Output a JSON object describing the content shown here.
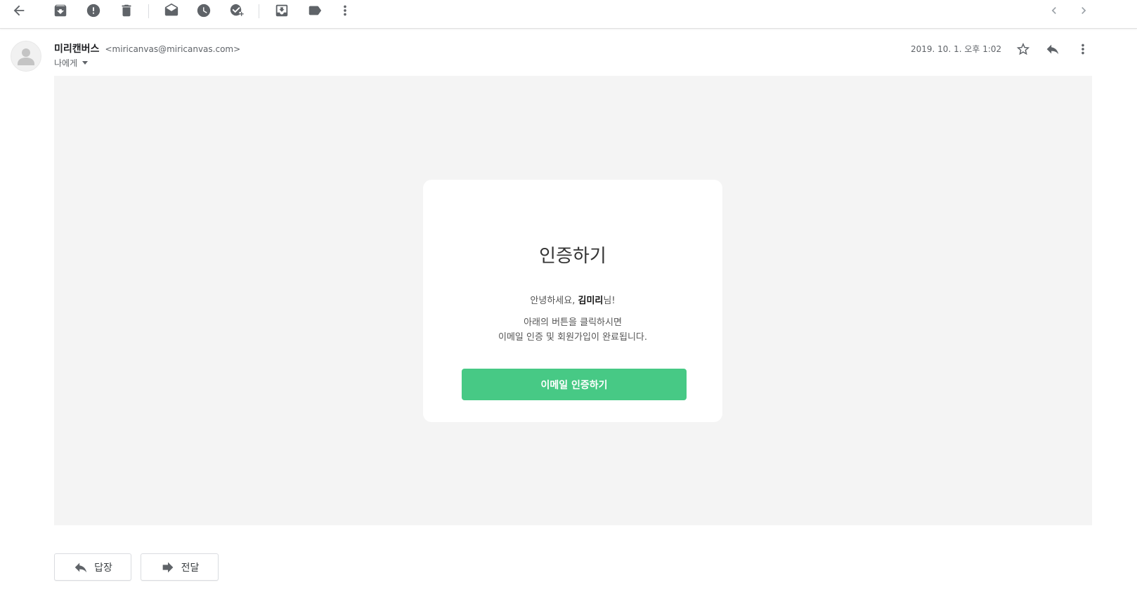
{
  "toolbar": {
    "icons": [
      "back-arrow-icon",
      "archive-icon",
      "report-spam-icon",
      "delete-icon",
      "mark-unread-icon",
      "snooze-icon",
      "add-to-tasks-icon",
      "move-to-icon",
      "label-icon",
      "more-vert-icon"
    ],
    "nav": [
      "chevron-left-icon",
      "chevron-right-icon"
    ]
  },
  "message": {
    "sender_name": "미리캔버스",
    "sender_email": "<miricanvas@miricanvas.com>",
    "to_label": "나에게",
    "date": "2019. 10. 1. 오후 1:02"
  },
  "card": {
    "title": "인증하기",
    "greeting_prefix": "안녕하세요, ",
    "greeting_name": "김미리",
    "greeting_suffix": "님!",
    "line1": "아래의 버튼을 클릭하시면",
    "line2": "이메일 인증 및 회원가입이 완료됩니다.",
    "button_label": "이메일 인증하기",
    "button_color": "#47c985"
  },
  "actions": {
    "reply_label": "답장",
    "forward_label": "전달"
  }
}
